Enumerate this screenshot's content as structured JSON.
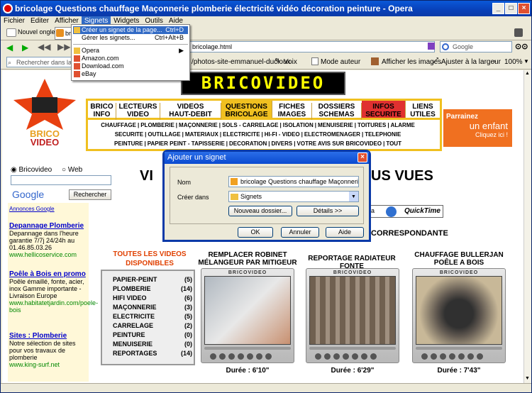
{
  "window": {
    "title": "bricolage Questions chauffage Maçonnerie plomberie électricité vidéo décoration peinture - Opera"
  },
  "menubar": [
    "Fichier",
    "Editer",
    "Afficher",
    "Signets",
    "Widgets",
    "Outils",
    "Aide"
  ],
  "tabs": {
    "new_tab": "Nouvel onglet",
    "tab_label": "bri"
  },
  "address": {
    "value": "bricolage.html",
    "search_placeholder": "Google"
  },
  "bookbar": {
    "search_placeholder": "Rechercher dans la p",
    "link": "/photos-site-emmanuel-ducloux",
    "voice": "Voix",
    "author_mode": "Mode auteur",
    "show_images": "Afficher les images",
    "fit_width": "Ajuster à la largeur",
    "zoom": "100%"
  },
  "dropdown": {
    "items": [
      {
        "label": "Créer un signet de la page...",
        "shortcut": "Ctrl+D"
      },
      {
        "label": "Gérer les signets...",
        "shortcut": "Ctrl+Alt+B"
      },
      {
        "label": "Opera",
        "shortcut": ""
      },
      {
        "label": "Amazon.com",
        "shortcut": ""
      },
      {
        "label": "Download.com",
        "shortcut": ""
      },
      {
        "label": "eBay",
        "shortcut": ""
      }
    ]
  },
  "page": {
    "ticker": "BRICOVIDEO",
    "logo": [
      "BRICO",
      "VIDEO"
    ],
    "nav": [
      "BRICO",
      "INFO",
      "LECTEURS",
      "VIDEO",
      "VIDEOS",
      "HAUT-DEBIT",
      "QUESTIONS",
      "BRICOLAGE",
      "FICHES",
      "IMAGES",
      "DOSSIERS",
      "SCHEMAS",
      "INFOS",
      "SECURITE",
      "LIENS",
      "UTILES"
    ],
    "cats1": [
      "CHAUFFAGE",
      "PLOMBERIE",
      "MAÇONNERIE",
      "SOLS - CARRELAGE",
      "ISOLATION",
      "MENUISERIE",
      "TOITURES",
      "ALARME"
    ],
    "cats2": [
      "SECURITE",
      "OUTILLAGE",
      "MATERIAUX",
      "ELECTRICITE",
      "HI-FI - VIDEO",
      "ELECTROMENAGER",
      "TELEPHONIE"
    ],
    "cats3": [
      "PEINTURE",
      "PAPIER PEINT - TAPISSERIE",
      "DECORATION",
      "DIVERS",
      "VOTRE AVIS SUR BRICOVIDEO",
      "TOUT"
    ],
    "sponsor": {
      "line1": "Parrainez",
      "line2": "un enfant",
      "line3": "Cliquez ici !"
    },
    "radio1": "Bricovideo",
    "radio2": "Web",
    "google": "Google",
    "search_btn": "Rechercher",
    "ads_title": "Annonces Google",
    "ads": [
      {
        "t": "Depannage Plomberie",
        "b": "Depannage dans l'heure garantie 7/7j 24/24h au 01.46.85.03.26",
        "u": "www.hellicoservice.com"
      },
      {
        "t": "Poêle à Bois en promo",
        "b": "Poêle émaillé, fonte, acier, inox Gamme importante - Livraison Europe",
        "u": "www.habitatetjardin.com/poele-bois"
      },
      {
        "t": "Sites : Plomberie",
        "b": "Notre sélection de sites pour vos travaux de plomberie",
        "u": "www.king-surf.net"
      }
    ],
    "heading_left": "VI",
    "heading_right": "US VUES",
    "media": "dia",
    "quicktime": "QuickTime",
    "correspondante": "CORRESPONDANTE",
    "all_videos": "TOUTES LES VIDEOS DISPONIBLES",
    "list": [
      [
        "PAPIER-PEINT",
        "(5)"
      ],
      [
        "PLOMBERIE",
        "(14)"
      ],
      [
        "HIFI VIDEO",
        "(6)"
      ],
      [
        "MAÇONNERIE",
        "(3)"
      ],
      [
        "ELECTRICITE",
        "(5)"
      ],
      [
        "CARRELAGE",
        "(2)"
      ],
      [
        "PEINTURE",
        "(0)"
      ],
      [
        "MENUISERIE",
        "(0)"
      ],
      [
        "REPORTAGES",
        "(14)"
      ]
    ],
    "player_label": "BRICOVIDEO",
    "videos": [
      {
        "title": "REMPLACER ROBINET MÉLANGEUR PAR MITIGEUR",
        "dur": "Durée : 6'10\""
      },
      {
        "title": "REPORTAGE RADIATEUR FONTE",
        "dur": "Durée : 6'29\""
      },
      {
        "title": "CHAUFFAGE BULLERJAN POÊLE A BOIS",
        "dur": "Durée : 7'43\""
      }
    ]
  },
  "dialog": {
    "title": "Ajouter un signet",
    "name_label": "Nom",
    "name_value": "bricolage Questions chauffage Maçonnerie plomber",
    "folder_label": "Créer dans",
    "folder_value": "Signets",
    "new_folder": "Nouveau dossier...",
    "details": "Détails >>",
    "ok": "OK",
    "cancel": "Annuler",
    "help": "Aide"
  }
}
